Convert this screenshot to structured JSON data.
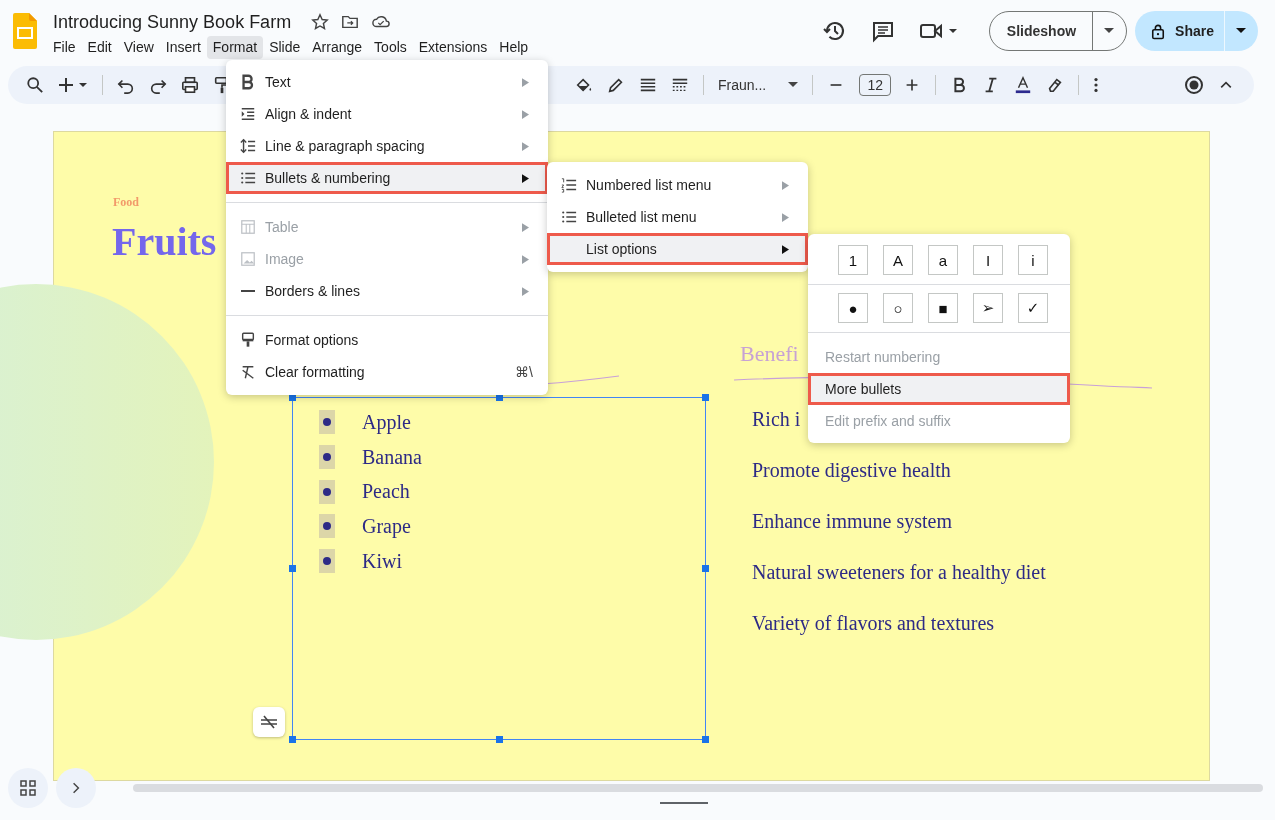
{
  "document": {
    "title": "Introducing Sunny Book Farm"
  },
  "menu_bar": [
    {
      "label": "File",
      "selected": false
    },
    {
      "label": "Edit",
      "selected": false
    },
    {
      "label": "View",
      "selected": false
    },
    {
      "label": "Insert",
      "selected": false
    },
    {
      "label": "Format",
      "selected": true
    },
    {
      "label": "Slide",
      "selected": false
    },
    {
      "label": "Arrange",
      "selected": false
    },
    {
      "label": "Tools",
      "selected": false
    },
    {
      "label": "Extensions",
      "selected": false
    },
    {
      "label": "Help",
      "selected": false
    }
  ],
  "header_buttons": {
    "slideshow": "Slideshow",
    "share": "Share"
  },
  "toolbar": {
    "font": "Fraun...",
    "font_size": "12"
  },
  "slide": {
    "eyebrow": "Food",
    "title": "Fruits",
    "subtitle": "Benefi",
    "fruits": [
      "Apple",
      "Banana",
      "Peach",
      "Grape",
      "Kiwi"
    ],
    "benefits": [
      "Rich i",
      "Promote digestive health",
      "Enhance immune system",
      "Natural sweeteners for a healthy diet",
      "Variety of flavors and textures"
    ]
  },
  "format_menu": [
    [
      {
        "label": "Text",
        "submenu": true,
        "disabled": false,
        "selected": false
      },
      {
        "label": "Align & indent",
        "submenu": true,
        "disabled": false,
        "selected": false
      },
      {
        "label": "Line & paragraph spacing",
        "submenu": true,
        "disabled": false,
        "selected": false
      },
      {
        "label": "Bullets & numbering",
        "submenu": true,
        "disabled": false,
        "selected": true
      }
    ],
    [
      {
        "label": "Table",
        "submenu": true,
        "disabled": true,
        "selected": false
      },
      {
        "label": "Image",
        "submenu": true,
        "disabled": true,
        "selected": false
      },
      {
        "label": "Borders & lines",
        "submenu": true,
        "disabled": false,
        "selected": false
      }
    ],
    [
      {
        "label": "Format options",
        "submenu": false,
        "disabled": false,
        "selected": false
      },
      {
        "label": "Clear formatting",
        "submenu": false,
        "disabled": false,
        "selected": false,
        "shortcut": "⌘\\"
      }
    ]
  ],
  "bullets_menu": [
    {
      "label": "Numbered list menu",
      "selected": false
    },
    {
      "label": "Bulleted list menu",
      "selected": false
    },
    {
      "label": "List options",
      "selected": true
    }
  ],
  "list_options": {
    "numbering_styles": [
      "1",
      "A",
      "a",
      "I",
      "i"
    ],
    "bullet_styles": [
      "●",
      "○",
      "■",
      "➢",
      "✓"
    ],
    "items": [
      {
        "label": "Restart numbering",
        "disabled": true,
        "selected": false
      },
      {
        "label": "More bullets",
        "disabled": false,
        "selected": true
      },
      {
        "label": "Edit prefix and suffix",
        "disabled": true,
        "selected": false
      }
    ]
  }
}
